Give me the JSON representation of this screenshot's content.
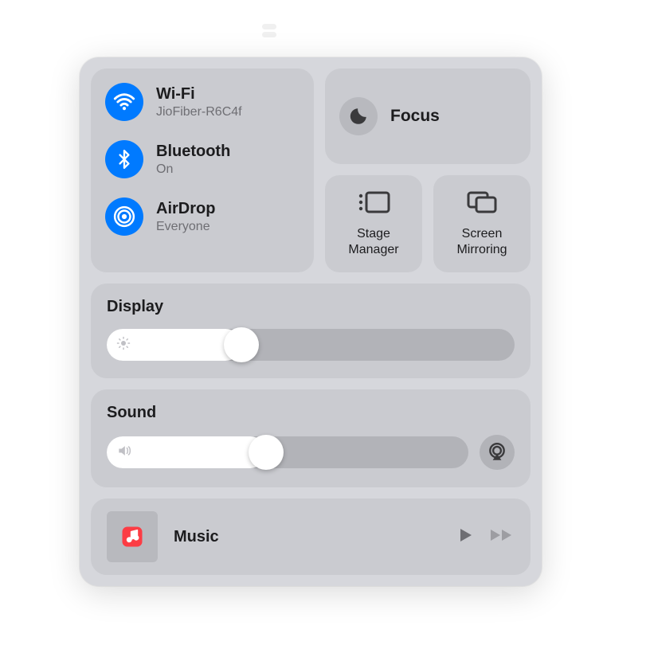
{
  "connectivity": {
    "wifi": {
      "title": "Wi-Fi",
      "subtitle": "JioFiber-R6C4f",
      "active": true
    },
    "bluetooth": {
      "title": "Bluetooth",
      "subtitle": "On",
      "active": true
    },
    "airdrop": {
      "title": "AirDrop",
      "subtitle": "Everyone",
      "active": true
    }
  },
  "focus": {
    "title": "Focus",
    "active": false
  },
  "stage_manager": {
    "label": "Stage\nManager"
  },
  "screen_mirroring": {
    "label": "Screen\nMirroring"
  },
  "display": {
    "title": "Display",
    "value_percent": 33
  },
  "sound": {
    "title": "Sound",
    "value_percent": 44
  },
  "music": {
    "title": "Music"
  },
  "colors": {
    "accent_blue": "#007aff",
    "music_red": "#fc3c44"
  }
}
